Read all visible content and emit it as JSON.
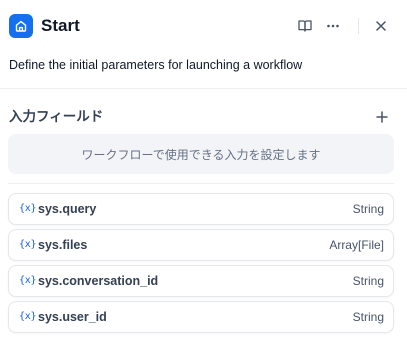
{
  "header": {
    "title": "Start",
    "accent_color": "#1570ef",
    "icons": [
      "home-icon",
      "book-open-icon",
      "more-icon",
      "close-icon"
    ]
  },
  "description": "Define the initial parameters for launching a workflow",
  "input_fields": {
    "title": "入力フィールド",
    "empty_text": "ワークフローで使用できる入力を設定します",
    "add_icon": "plus-icon"
  },
  "system_variables": [
    {
      "icon": "{x}",
      "name": "sys.query",
      "type": "String"
    },
    {
      "icon": "{x}",
      "name": "sys.files",
      "type": "Array[File]"
    },
    {
      "icon": "{x}",
      "name": "sys.conversation_id",
      "type": "String"
    },
    {
      "icon": "{x}",
      "name": "sys.user_id",
      "type": "String"
    }
  ]
}
